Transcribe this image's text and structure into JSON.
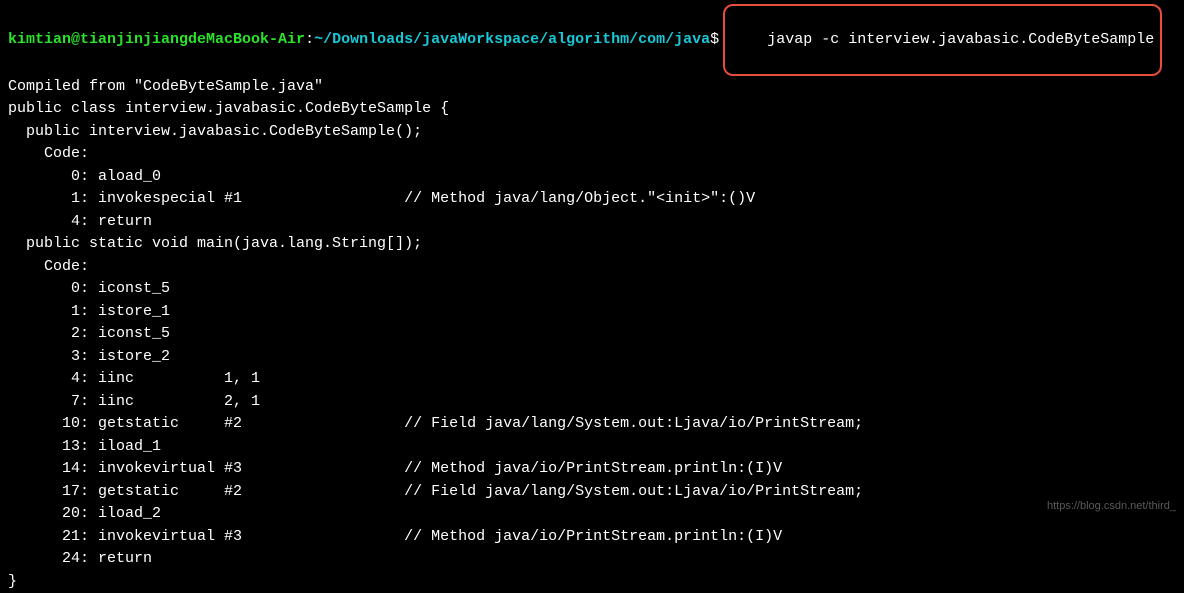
{
  "prompt": {
    "user_host": "kimtian@tianjinjiangdeMacBook-Air",
    "colon": ":",
    "path": "~/Downloads/javaWorkspace/algorithm/com/java",
    "dollar": "$",
    "command": "javap -c interview.javabasic.CodeByteSample"
  },
  "lines": {
    "l00": "Compiled from \"CodeByteSample.java\"",
    "l01": "public class interview.javabasic.CodeByteSample {",
    "l02": "  public interview.javabasic.CodeByteSample();",
    "l03": "    Code:",
    "l04": "       0: aload_0",
    "l05": "       1: invokespecial #1                  // Method java/lang/Object.\"<init>\":()V",
    "l06": "       4: return",
    "l07": "",
    "l08": "  public static void main(java.lang.String[]);",
    "l09": "    Code:",
    "l10": "       0: iconst_5",
    "l11": "       1: istore_1",
    "l12": "       2: iconst_5",
    "l13": "       3: istore_2",
    "l14": "       4: iinc          1, 1",
    "l15": "       7: iinc          2, 1",
    "l16": "      10: getstatic     #2                  // Field java/lang/System.out:Ljava/io/PrintStream;",
    "l17": "      13: iload_1",
    "l18": "      14: invokevirtual #3                  // Method java/io/PrintStream.println:(I)V",
    "l19": "      17: getstatic     #2                  // Field java/lang/System.out:Ljava/io/PrintStream;",
    "l20": "      20: iload_2",
    "l21": "      21: invokevirtual #3                  // Method java/io/PrintStream.println:(I)V",
    "l22": "      24: return",
    "l23": "}"
  },
  "watermark": "https://blog.csdn.net/third_"
}
